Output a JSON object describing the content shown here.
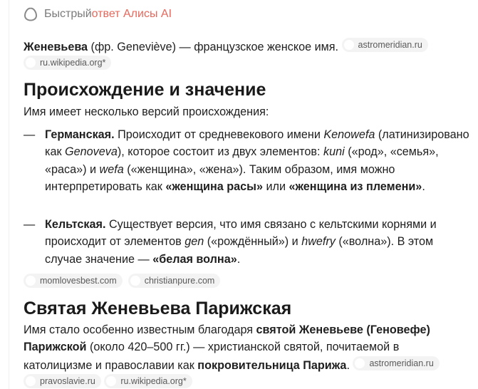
{
  "header": {
    "title_plain": "Быстрый ",
    "title_accent": "ответ Алисы AI",
    "icon": "alice-icon"
  },
  "intro": {
    "name": "Женевьева",
    "rest": " (фр. Geneviève) — французское женское имя. ",
    "sources": [
      "astromeridian.ru",
      "ru.wikipedia.org*"
    ]
  },
  "section1": {
    "title": "Происхождение и значение",
    "lead": "Имя имеет несколько версий происхождения:",
    "items": [
      {
        "dash": "—",
        "parts": [
          {
            "t": "Германская.",
            "s": "b"
          },
          {
            "t": " Происходит от средневекового имени "
          },
          {
            "t": "Kenowefa",
            "s": "i"
          },
          {
            "t": " (латинизировано как "
          },
          {
            "t": "Genoveva",
            "s": "i"
          },
          {
            "t": "), которое состоит из двух элементов: "
          },
          {
            "t": "kuni",
            "s": "i"
          },
          {
            "t": " («род», «семья», «раса») и "
          },
          {
            "t": "wefa",
            "s": "i"
          },
          {
            "t": " («женщина», «жена»). Таким образом, имя можно интерпретировать как "
          },
          {
            "t": "«женщина расы»",
            "s": "b"
          },
          {
            "t": " или "
          },
          {
            "t": "«женщина из племени»",
            "s": "b"
          },
          {
            "t": "."
          }
        ]
      },
      {
        "dash": "—",
        "parts": [
          {
            "t": "Кельтская.",
            "s": "b"
          },
          {
            "t": " Существует версия, что имя связано с кельтскими корнями и происходит от элементов "
          },
          {
            "t": "gen",
            "s": "i"
          },
          {
            "t": " («рождённый») и "
          },
          {
            "t": "hwefry",
            "s": "i"
          },
          {
            "t": " («волна»). В этом случае значение — "
          },
          {
            "t": "«белая волна»",
            "s": "b"
          },
          {
            "t": "."
          }
        ]
      }
    ],
    "sources": [
      "momlovesbest.com",
      "christianpure.com"
    ]
  },
  "section2": {
    "title": "Святая Женевьева Парижская",
    "parts": [
      {
        "t": "Имя стало особенно известным благодаря "
      },
      {
        "t": "святой Женевьеве (Геновефе) Парижской",
        "s": "b"
      },
      {
        "t": " (около 420–500 гг.) — христианской святой, почитаемой в католицизме и православии как "
      },
      {
        "t": "покровительница Парижа",
        "s": "b"
      },
      {
        "t": ". "
      }
    ],
    "sources": [
      "astromeridian.ru",
      "pravoslavie.ru",
      "ru.wikipedia.org*"
    ]
  }
}
